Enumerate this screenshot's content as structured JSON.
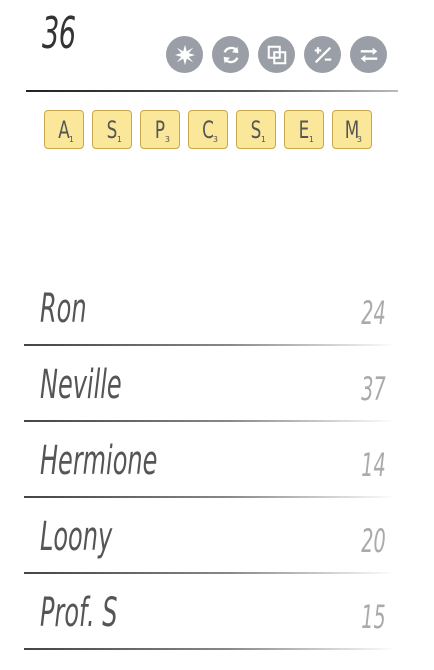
{
  "score": "36",
  "toolbar": {
    "buttons": [
      {
        "icon": "burst-icon"
      },
      {
        "icon": "refresh-icon"
      },
      {
        "icon": "overlap-squares-icon"
      },
      {
        "icon": "percent-icon"
      },
      {
        "icon": "swap-arrows-icon"
      }
    ]
  },
  "rack": [
    {
      "letter": "A",
      "points": "1"
    },
    {
      "letter": "S",
      "points": "1"
    },
    {
      "letter": "P",
      "points": "3"
    },
    {
      "letter": "C",
      "points": "3"
    },
    {
      "letter": "S",
      "points": "1"
    },
    {
      "letter": "E",
      "points": "1"
    },
    {
      "letter": "M",
      "points": "3"
    }
  ],
  "players": [
    {
      "name": "Ron",
      "score": "24"
    },
    {
      "name": "Neville",
      "score": "37"
    },
    {
      "name": "Hermione",
      "score": "14"
    },
    {
      "name": "Loony",
      "score": "20"
    },
    {
      "name": "Prof. S",
      "score": "15"
    }
  ],
  "colors": {
    "tile_fill": "#fae79a",
    "tile_border": "#c9a74a",
    "button_fill": "#9a9ea6"
  }
}
